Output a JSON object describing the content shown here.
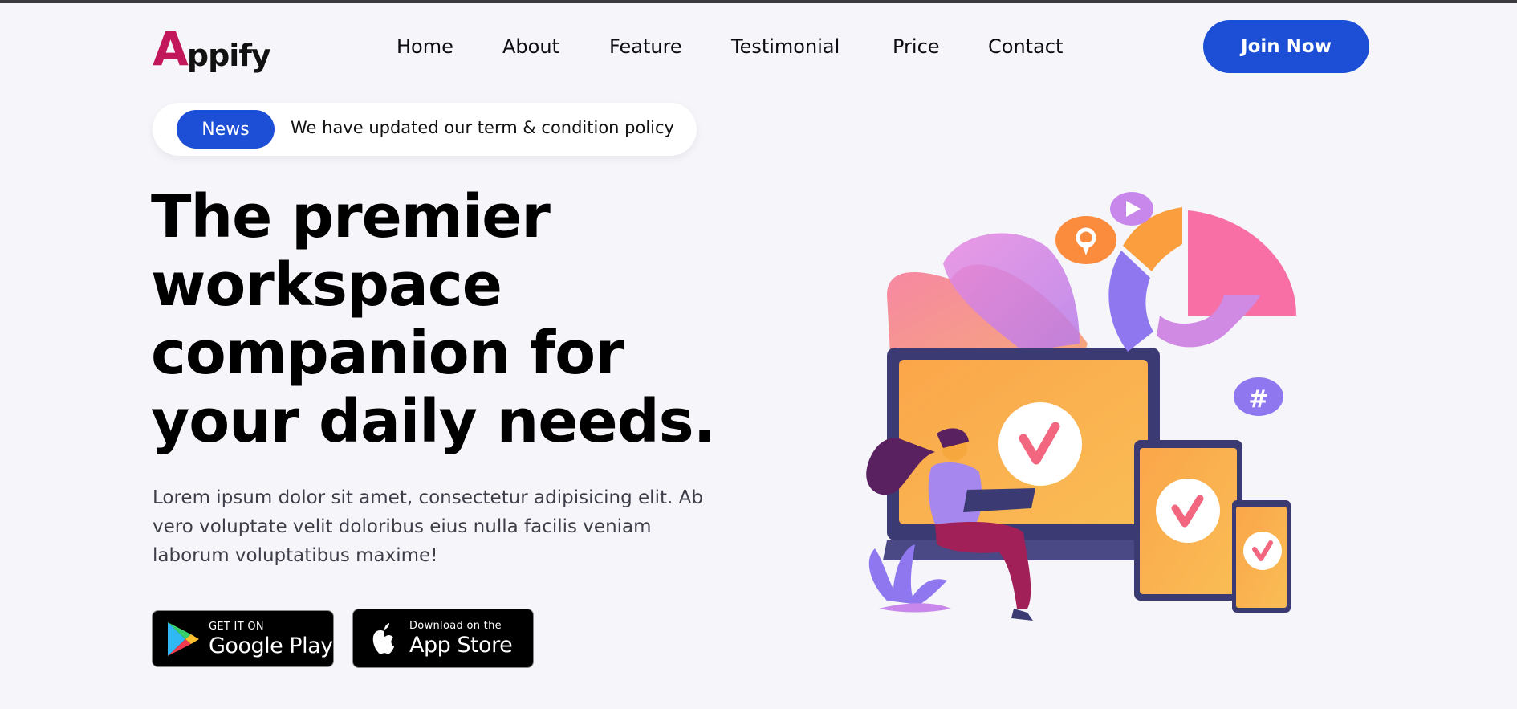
{
  "header": {
    "logo": {
      "first": "A",
      "rest": "ppify"
    },
    "nav": [
      "Home",
      "About",
      "Feature",
      "Testimonial",
      "Price",
      "Contact"
    ],
    "cta": "Join Now"
  },
  "news": {
    "badge": "News",
    "text": "We have updated our term & condition policy"
  },
  "hero": {
    "title_lines": [
      "The premier",
      "workspace",
      "companion for",
      "your daily needs."
    ],
    "description": "Lorem ipsum dolor sit amet, consectetur adipisicing elit. Ab vero voluptate velit doloribus eius nulla facilis veniam laborum voluptatibus maxime!"
  },
  "stores": {
    "google": {
      "small": "GET IT ON",
      "big": "Google Play",
      "icon": "google-play-icon"
    },
    "apple": {
      "small": "Download on the",
      "big": "App Store",
      "icon": "apple-icon"
    }
  },
  "colors": {
    "accent": "#1c4fd6",
    "logo": "#c2185b",
    "background": "#f5f5fa"
  }
}
